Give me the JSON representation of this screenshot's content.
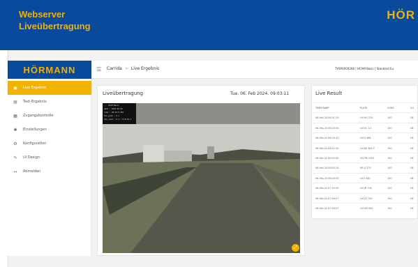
{
  "banner": {
    "line1": "Webserver",
    "line2": "Liveübertragung",
    "brand": "HÖR"
  },
  "sidebar": {
    "logo": "HÖRMANN",
    "items": [
      {
        "icon": "live-icon",
        "label": "Live Ergebnis",
        "active": true
      },
      {
        "icon": "text-icon",
        "label": "Text-Ergebnis",
        "active": false
      },
      {
        "icon": "access-icon",
        "label": "Zugangskontrolle",
        "active": false
      },
      {
        "icon": "gear-icon",
        "label": "Einstellungen",
        "active": false
      },
      {
        "icon": "config-icon",
        "label": "Konfiguration",
        "active": false
      },
      {
        "icon": "brush-icon",
        "label": "UI Design",
        "active": false
      },
      {
        "icon": "logout-icon",
        "label": "Abmelden",
        "active": false
      }
    ]
  },
  "header": {
    "breadcrumb": [
      "Carrida",
      "Live Ergebnis"
    ],
    "breadcrumb_sep": ">",
    "info": "TVSP4000308 | HCAM Basic | Standard Eu"
  },
  "live": {
    "title": "Liveübertragung",
    "datetime": "Tue, 06. Feb 2024, 09:03:11",
    "overlay_lines": [
      "... HCAM Basic",
      "date    : 2024-02-06",
      "time    : 09:03:5.984",
      "fps_grab : 9.1",
      "fps_read : 9.4 / 8.8/10.2"
    ]
  },
  "result": {
    "title": "Live Result",
    "columns": [
      "TIMESTAMP",
      "PLATE",
      "CONF",
      "CO"
    ],
    "rows": [
      [
        "06-Feb-24 08:31:29",
        "LM HS 235",
        "100",
        "DE"
      ],
      [
        "06-Feb-24 08:22:54",
        "LM VC 13",
        "100",
        "DE"
      ],
      [
        "06-Feb-24 08:16:12",
        "LM E 464",
        "100",
        "DE"
      ],
      [
        "06-Feb-24 08:11:59",
        "LM BE 802 E",
        "100",
        "DE"
      ],
      [
        "06-Feb-24 08:02:09",
        "HG PB 1920",
        "100",
        "DE"
      ],
      [
        "06-Feb-24 08:02:24",
        "KR S 373",
        "100",
        "DE"
      ],
      [
        "06-Feb-24 08:00:03",
        "LM J 344",
        "100",
        "DE"
      ],
      [
        "06-Feb-24 07:52:59",
        "LM JB 795",
        "100",
        "DE"
      ],
      [
        "06-Feb-24 07:49:07",
        "LM LE 239",
        "100",
        "DE"
      ],
      [
        "06-Feb-24 07:40:07",
        "LM MS 563",
        "100",
        "DE"
      ]
    ]
  },
  "colors": {
    "banner": "#0a4a9c",
    "accent": "#f2b200"
  }
}
